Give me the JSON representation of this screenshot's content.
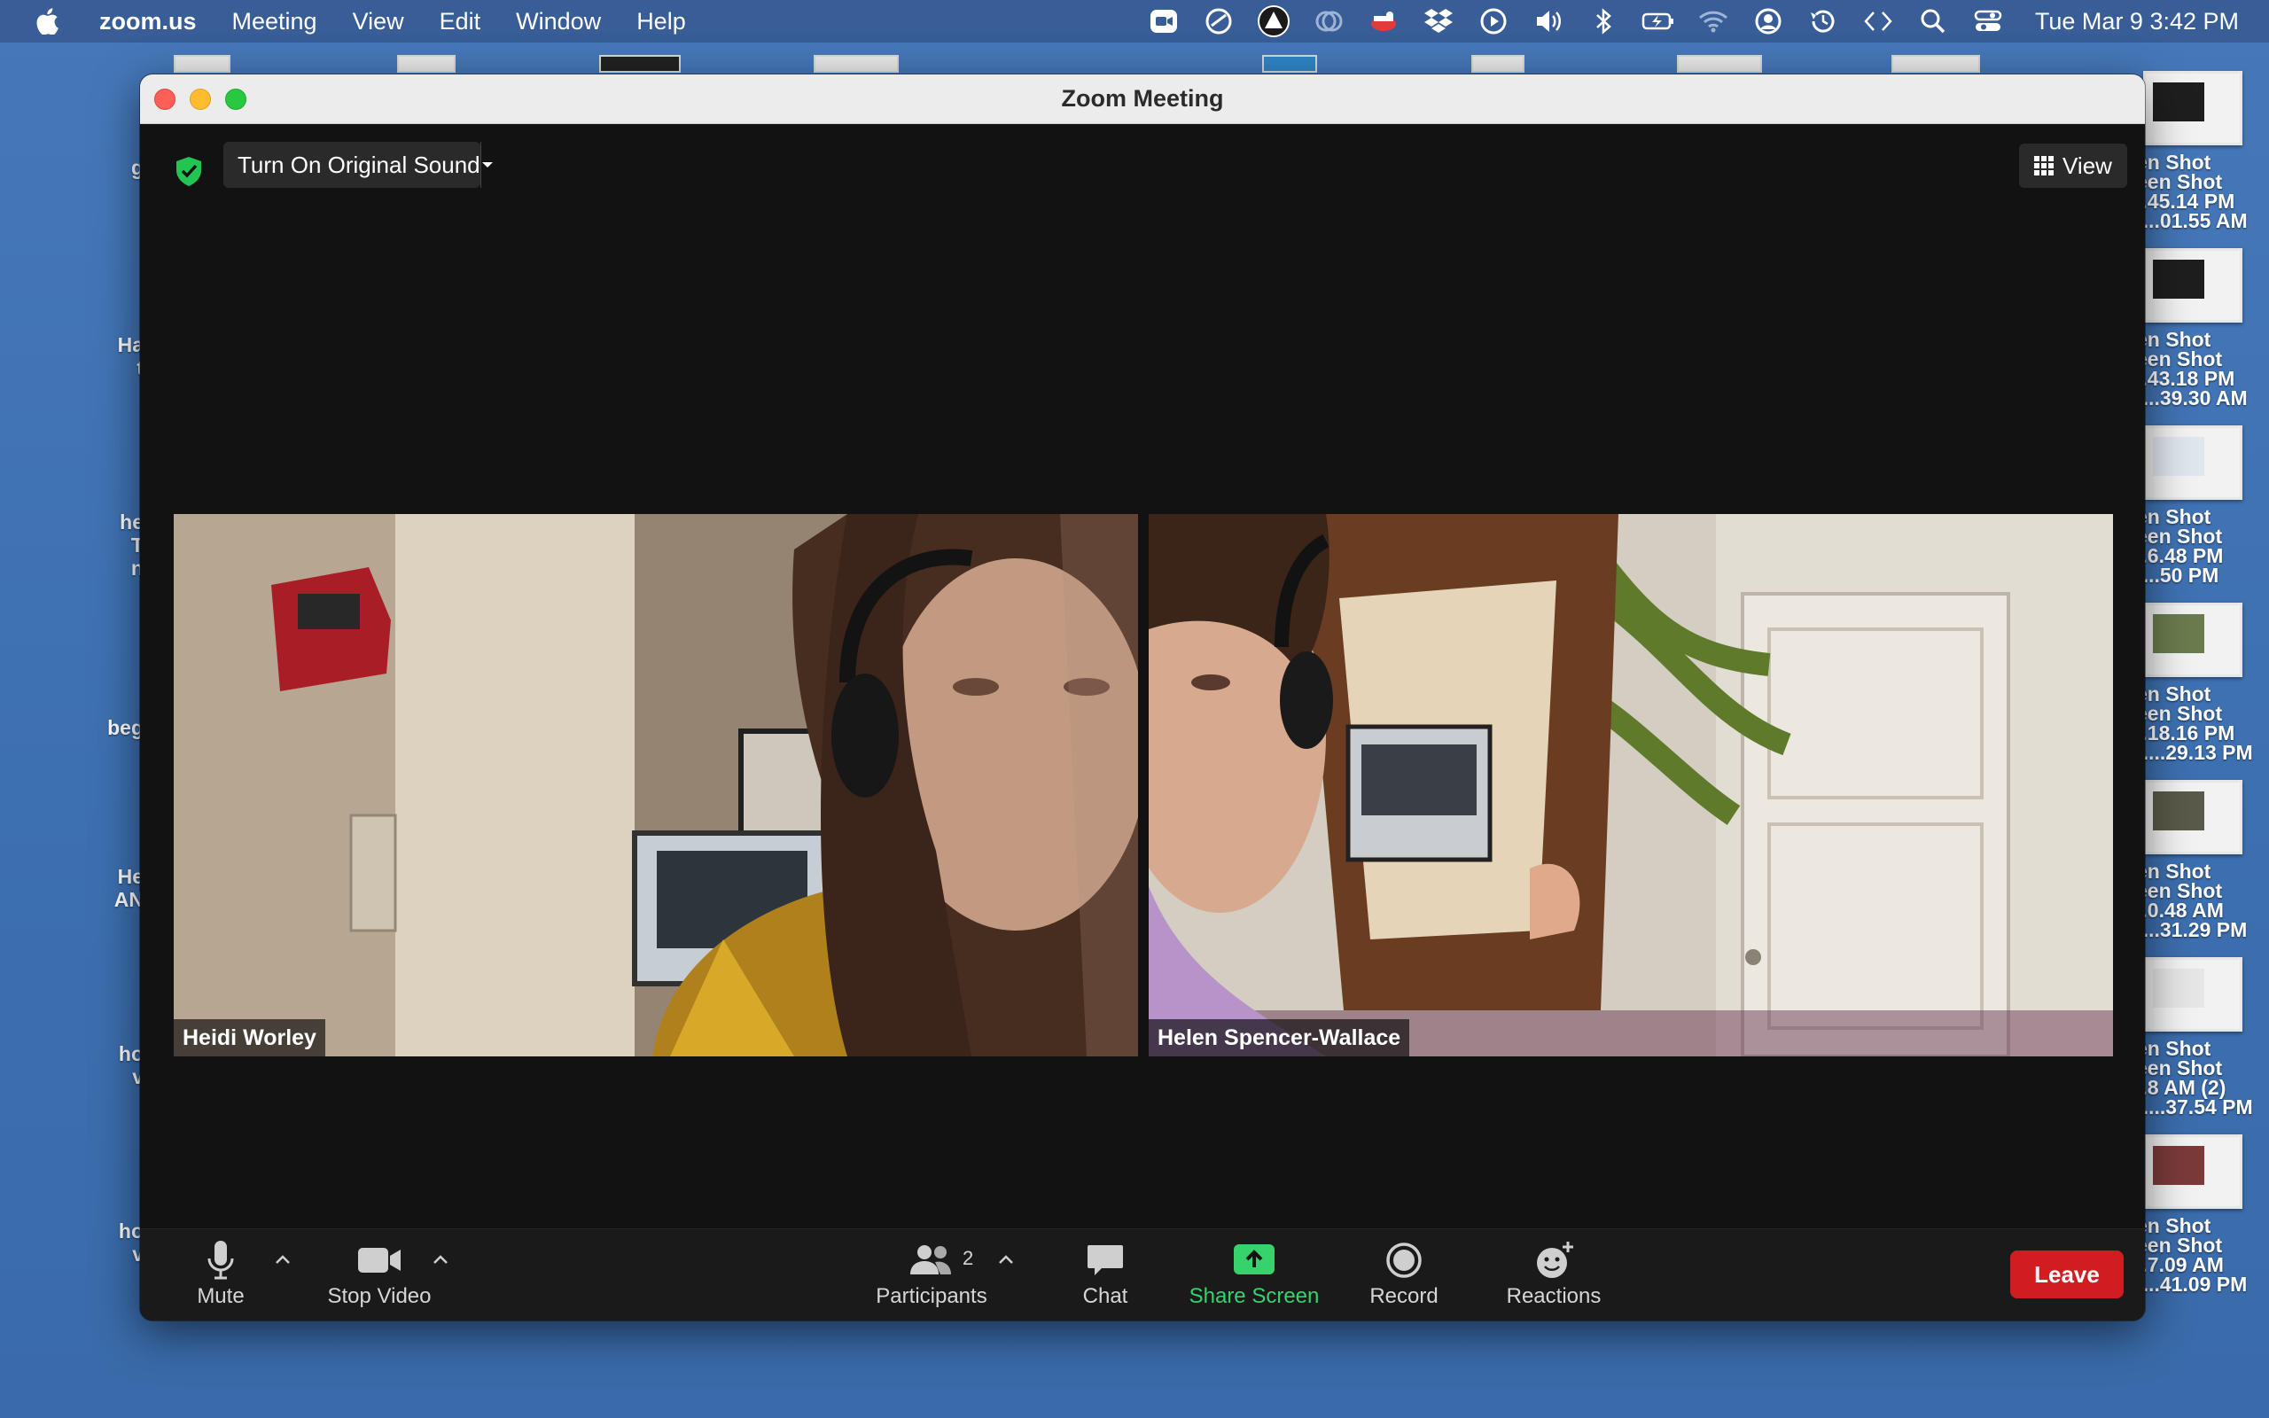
{
  "menubar": {
    "app_name": "zoom.us",
    "menus": [
      "Meeting",
      "View",
      "Edit",
      "Window",
      "Help"
    ],
    "clock": "Tue Mar 9  3:42 PM",
    "status_icons": [
      "zoom-icon",
      "sync-icon",
      "triangle-app-icon",
      "eye-icon",
      "extension-icon",
      "dropbox-icon",
      "play-icon",
      "volume-icon",
      "bluetooth-icon",
      "battery-icon",
      "wifi-icon",
      "user-icon",
      "time-machine-icon",
      "code-icon",
      "search-icon",
      "control-center-icon"
    ]
  },
  "desktop": {
    "left_labels": [
      "g",
      "Ha\n t",
      "he\n T\n n",
      "beg",
      "He\nAN",
      "ho\n v",
      "ho\n v"
    ],
    "right_items": [
      {
        "label": "en Shot\neen Shot\n..45.14 PM\n)...01.55 AM"
      },
      {
        "label": "en Shot\neen Shot\n..43.18 PM\n)...39.30 AM"
      },
      {
        "label": "en Shot\neen Shot\n..6.48 PM\n)...50 PM"
      },
      {
        "label": "en Shot\neen Shot\n..18.16 PM\n)....29.13 PM"
      },
      {
        "label": "en Shot\neen Shot\n..0.48 AM\n)...31.29 PM"
      },
      {
        "label": "en Shot\neen Shot\n..8 AM (2)\n)....37.54 PM"
      },
      {
        "label": "en Shot\neen Shot\n..7.09 AM\n)...41.09 PM"
      }
    ]
  },
  "window": {
    "title": "Zoom Meeting",
    "original_sound_label": "Turn On Original Sound",
    "view_label": "View"
  },
  "participants": [
    {
      "name": "Heidi Worley"
    },
    {
      "name": "Helen Spencer-Wallace"
    }
  ],
  "controls": {
    "mute": "Mute",
    "stop_video": "Stop Video",
    "participants": "Participants",
    "participant_count": "2",
    "chat": "Chat",
    "share_screen": "Share Screen",
    "record": "Record",
    "reactions": "Reactions",
    "leave": "Leave"
  },
  "colors": {
    "share_green": "#36d36c",
    "leave_red": "#d11d22",
    "shield_green": "#23c552"
  }
}
